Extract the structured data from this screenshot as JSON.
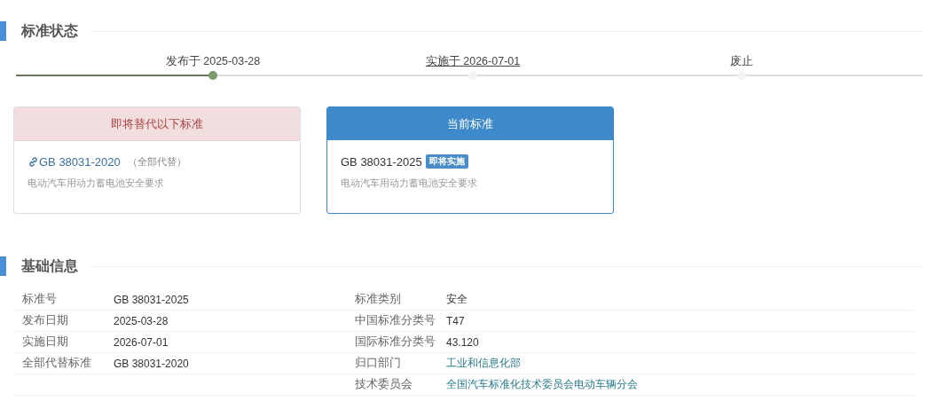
{
  "status_section": {
    "title": "标准状态",
    "timeline": {
      "level": 0.217,
      "steps": [
        {
          "label": "发布于 2025-03-28",
          "done": true,
          "link": false
        },
        {
          "label": "实施于 2026-07-01",
          "done": false,
          "link": true
        },
        {
          "label": "废止",
          "done": false,
          "link": false
        }
      ]
    },
    "cards": [
      {
        "kind": "replaced",
        "header": "即将替代以下标准",
        "code": "GB 38031-2020",
        "note": "（全部代替）",
        "title": "电动汽车用动力蓄电池安全要求"
      },
      {
        "kind": "current",
        "header": "当前标准",
        "code": "GB 38031-2025",
        "badge": "即将实施",
        "title": "电动汽车用动力蓄电池安全要求"
      }
    ]
  },
  "info_section": {
    "title": "基础信息",
    "rows": [
      [
        {
          "label": "标准号",
          "value": "GB 38031-2025",
          "link": false
        },
        {
          "label": "标准类别",
          "value": "安全",
          "link": false
        }
      ],
      [
        {
          "label": "发布日期",
          "value": "2025-03-28",
          "link": false
        },
        {
          "label": "中国标准分类号",
          "value": "T47",
          "link": false
        }
      ],
      [
        {
          "label": "实施日期",
          "value": "2026-07-01",
          "link": false
        },
        {
          "label": "国际标准分类号",
          "value": "43.120",
          "link": false
        }
      ],
      [
        {
          "label": "全部代替标准",
          "value": "GB 38031-2020",
          "link": false
        },
        {
          "label": "归口部门",
          "value": "工业和信息化部",
          "link": true
        }
      ],
      [
        null,
        {
          "label": "技术委员会",
          "value": "全国汽车标准化技术委员会电动车辆分会",
          "link": true
        }
      ]
    ]
  }
}
